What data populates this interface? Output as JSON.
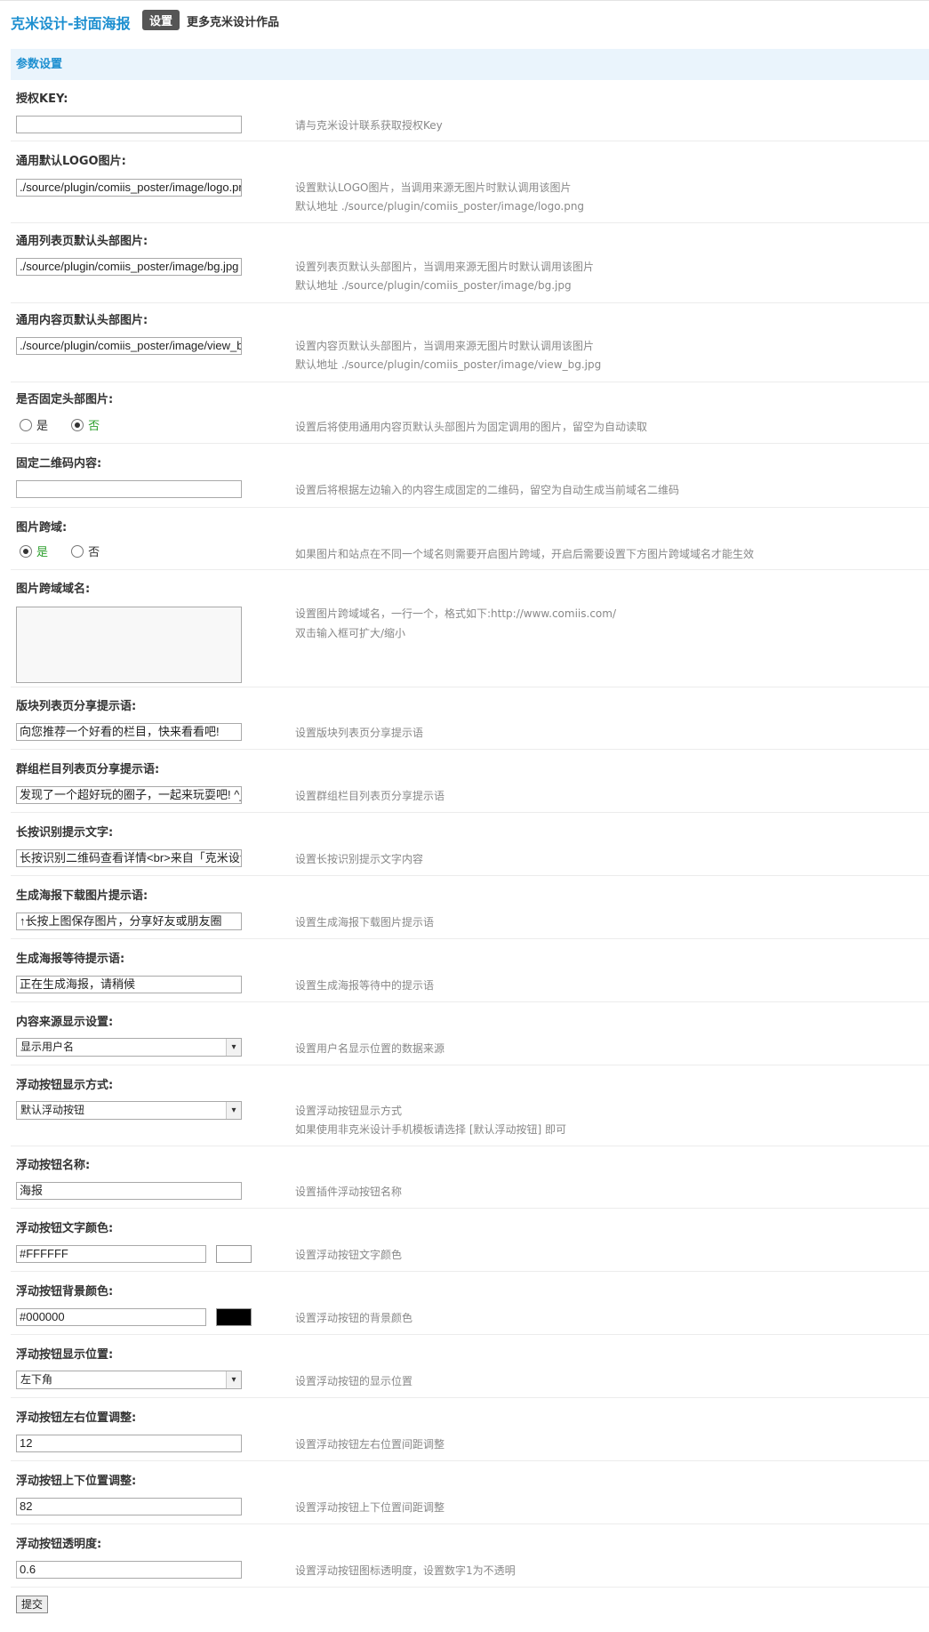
{
  "header": {
    "app_title": "克米设计-封面海报",
    "tab_active": "设置",
    "tab_more": "更多克米设计作品"
  },
  "section": {
    "title": "参数设置"
  },
  "fields": {
    "auth_key": {
      "label": "授权KEY:",
      "value": "",
      "desc": "请与克米设计联系获取授权Key"
    },
    "logo": {
      "label": "通用默认LOGO图片:",
      "value": "./source/plugin/comiis_poster/image/logo.png",
      "desc1": "设置默认LOGO图片，当调用来源无图片时默认调用该图片",
      "desc2": "默认地址 ./source/plugin/comiis_poster/image/logo.png"
    },
    "list_header": {
      "label": "通用列表页默认头部图片:",
      "value": "./source/plugin/comiis_poster/image/bg.jpg",
      "desc1": "设置列表页默认头部图片，当调用来源无图片时默认调用该图片",
      "desc2": "默认地址 ./source/plugin/comiis_poster/image/bg.jpg"
    },
    "view_header": {
      "label": "通用内容页默认头部图片:",
      "value": "./source/plugin/comiis_poster/image/view_bg.jpg",
      "desc1": "设置内容页默认头部图片，当调用来源无图片时默认调用该图片",
      "desc2": "默认地址 ./source/plugin/comiis_poster/image/view_bg.jpg"
    },
    "fixed_header": {
      "label": "是否固定头部图片:",
      "opt_yes": "是",
      "opt_no": "否",
      "selected": "否",
      "desc": "设置后将使用通用内容页默认头部图片为固定调用的图片，留空为自动读取"
    },
    "fixed_qr": {
      "label": "固定二维码内容:",
      "value": "",
      "desc": "设置后将根据左边输入的内容生成固定的二维码，留空为自动生成当前域名二维码"
    },
    "cross_domain": {
      "label": "图片跨域:",
      "opt_yes": "是",
      "opt_no": "否",
      "selected": "是",
      "desc": "如果图片和站点在不同一个域名则需要开启图片跨域，开启后需要设置下方图片跨域域名才能生效"
    },
    "cross_domain_names": {
      "label": "图片跨域域名:",
      "desc1": "设置图片跨域域名，一行一个，格式如下:http://www.comiis.com/",
      "desc2": "双击输入框可扩大/缩小"
    },
    "forum_share": {
      "label": "版块列表页分享提示语:",
      "value": "向您推荐一个好看的栏目，快来看看吧!",
      "desc": "设置版块列表页分享提示语"
    },
    "group_share": {
      "label": "群组栏目列表页分享提示语:",
      "value": "发现了一个超好玩的圈子，一起来玩耍吧! ^_^",
      "desc": "设置群组栏目列表页分享提示语"
    },
    "long_press": {
      "label": "长按识别提示文字:",
      "value": "长按识别二维码查看详情<br>来自「克米设计」",
      "desc": "设置长按识别提示文字内容"
    },
    "download_tip": {
      "label": "生成海报下载图片提示语:",
      "value": "↑长按上图保存图片，分享好友或朋友圈",
      "desc": "设置生成海报下载图片提示语"
    },
    "waiting_tip": {
      "label": "生成海报等待提示语:",
      "value": "正在生成海报，请稍候",
      "desc": "设置生成海报等待中的提示语"
    },
    "source_display": {
      "label": "内容来源显示设置:",
      "value": "显示用户名",
      "desc": "设置用户名显示位置的数据来源"
    },
    "float_mode": {
      "label": "浮动按钮显示方式:",
      "value": "默认浮动按钮",
      "desc1": "设置浮动按钮显示方式",
      "desc2": "如果使用非克米设计手机模板请选择 [默认浮动按钮] 即可"
    },
    "float_name": {
      "label": "浮动按钮名称:",
      "value": "海报",
      "desc": "设置插件浮动按钮名称"
    },
    "float_text_color": {
      "label": "浮动按钮文字颜色:",
      "value": "#FFFFFF",
      "swatch": "#ffffff",
      "desc": "设置浮动按钮文字颜色"
    },
    "float_bg_color": {
      "label": "浮动按钮背景颜色:",
      "value": "#000000",
      "swatch": "#000000",
      "desc": "设置浮动按钮的背景颜色"
    },
    "float_position": {
      "label": "浮动按钮显示位置:",
      "value": "左下角",
      "desc": "设置浮动按钮的显示位置"
    },
    "float_lr": {
      "label": "浮动按钮左右位置调整:",
      "value": "12",
      "desc": "设置浮动按钮左右位置间距调整"
    },
    "float_ud": {
      "label": "浮动按钮上下位置调整:",
      "value": "82",
      "desc": "设置浮动按钮上下位置间距调整"
    },
    "float_opacity": {
      "label": "浮动按钮透明度:",
      "value": "0.6",
      "desc": "设置浮动按钮图标透明度，设置数字1为不透明"
    }
  },
  "submit_label": "提交"
}
